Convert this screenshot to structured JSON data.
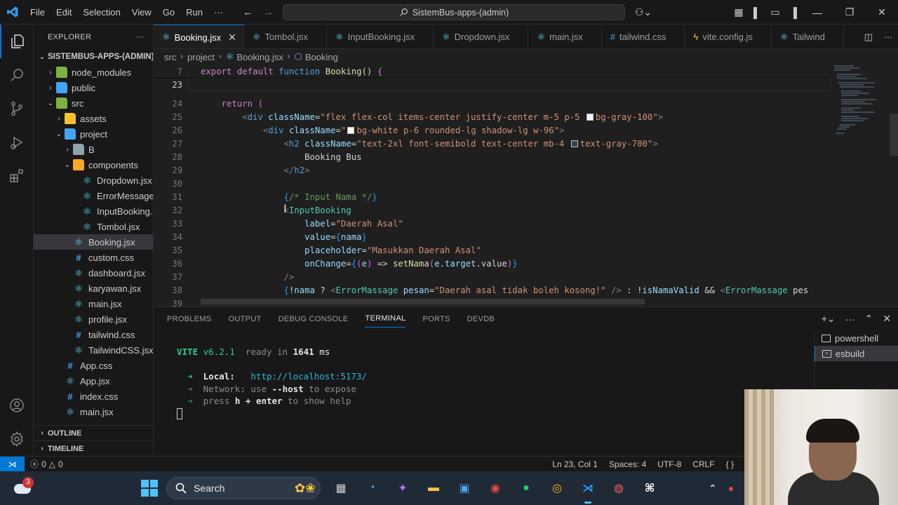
{
  "menu": [
    "File",
    "Edit",
    "Selection",
    "View",
    "Go",
    "Run",
    "···"
  ],
  "command_center": "SistemBus-apps-(admin)",
  "explorer": {
    "title": "EXPLORER",
    "root": "SISTEMBUS-APPS-(ADMIN)",
    "items": [
      {
        "label": "node_modules",
        "depth": 1,
        "kind": "folder-green",
        "chev": "›"
      },
      {
        "label": "public",
        "depth": 1,
        "kind": "folder-blue",
        "chev": "›"
      },
      {
        "label": "src",
        "depth": 1,
        "kind": "folder-green",
        "chev": "⌄"
      },
      {
        "label": "assets",
        "depth": 2,
        "kind": "folder-orange",
        "chev": "›"
      },
      {
        "label": "project",
        "depth": 2,
        "kind": "folder-blue",
        "chev": "⌄"
      },
      {
        "label": "B",
        "depth": 3,
        "kind": "folder-gray",
        "chev": "›"
      },
      {
        "label": "components",
        "depth": 3,
        "kind": "folder-yellow",
        "chev": "⌄"
      },
      {
        "label": "Dropdown.jsx",
        "depth": 4,
        "kind": "react"
      },
      {
        "label": "ErrorMessage...",
        "depth": 4,
        "kind": "react"
      },
      {
        "label": "InputBooking...",
        "depth": 4,
        "kind": "react"
      },
      {
        "label": "Tombol.jsx",
        "depth": 4,
        "kind": "react"
      },
      {
        "label": "Booking.jsx",
        "depth": 3,
        "kind": "react",
        "selected": true
      },
      {
        "label": "custom.css",
        "depth": 3,
        "kind": "css"
      },
      {
        "label": "dashboard.jsx",
        "depth": 3,
        "kind": "react"
      },
      {
        "label": "karyawan.jsx",
        "depth": 3,
        "kind": "react"
      },
      {
        "label": "main.jsx",
        "depth": 3,
        "kind": "react"
      },
      {
        "label": "profile.jsx",
        "depth": 3,
        "kind": "react"
      },
      {
        "label": "tailwind.css",
        "depth": 3,
        "kind": "css"
      },
      {
        "label": "TailwindCSS.jsx",
        "depth": 3,
        "kind": "react"
      },
      {
        "label": "App.css",
        "depth": 2,
        "kind": "css"
      },
      {
        "label": "App.jsx",
        "depth": 2,
        "kind": "react"
      },
      {
        "label": "index.css",
        "depth": 2,
        "kind": "css"
      },
      {
        "label": "main.jsx",
        "depth": 2,
        "kind": "react"
      }
    ],
    "outline": "OUTLINE",
    "timeline": "TIMELINE"
  },
  "tabs": [
    {
      "label": "Booking.jsx",
      "icon": "react",
      "active": true
    },
    {
      "label": "Tombol.jsx",
      "icon": "react"
    },
    {
      "label": "InputBooking.jsx",
      "icon": "react"
    },
    {
      "label": "Dropdown.jsx",
      "icon": "react"
    },
    {
      "label": "main.jsx",
      "icon": "react"
    },
    {
      "label": "tailwind.css",
      "icon": "css"
    },
    {
      "label": "vite.config.js",
      "icon": "vite"
    },
    {
      "label": "Tailwind",
      "icon": "react"
    }
  ],
  "breadcrumb": [
    "src",
    "project",
    "Booking.jsx",
    "Booking"
  ],
  "editor": {
    "sticky_line": {
      "n": "7",
      "text": "export default function Booking() {"
    },
    "current_line": "23",
    "lines": [
      {
        "n": "24",
        "text": "    return ("
      },
      {
        "n": "25",
        "text": "        <div className=\"flex flex-col items-center justify-center m-5 p-5 bg-gray-100\">"
      },
      {
        "n": "26",
        "text": "            <div className=\"bg-white p-6 rounded-lg shadow-lg w-96\">"
      },
      {
        "n": "27",
        "text": "                <h2 className=\"text-2xl font-semibold text-center mb-4 text-gray-700\">"
      },
      {
        "n": "28",
        "text": "                    Booking Bus"
      },
      {
        "n": "29",
        "text": "                </h2>"
      },
      {
        "n": "30",
        "text": ""
      },
      {
        "n": "31",
        "text": "                {/* Input Nama */}"
      },
      {
        "n": "32",
        "text": "                <InputBooking"
      },
      {
        "n": "33",
        "text": "                    label=\"Daerah Asal\""
      },
      {
        "n": "34",
        "text": "                    value={nama}"
      },
      {
        "n": "35",
        "text": "                    placeholder=\"Masukkan Daerah Asal\""
      },
      {
        "n": "36",
        "text": "                    onChange={(e) => setNama(e.target.value)}"
      },
      {
        "n": "37",
        "text": "                />"
      },
      {
        "n": "38",
        "text": "                {!nama ? <ErrorMassage pesan=\"Daerah asal tidak boleh kosong!\" /> : !isNamaValid && <ErrorMassage pes"
      },
      {
        "n": "39",
        "text": ""
      }
    ]
  },
  "panel": {
    "tabs": [
      "PROBLEMS",
      "OUTPUT",
      "DEBUG CONSOLE",
      "TERMINAL",
      "PORTS",
      "DEVDB"
    ],
    "active_tab": "TERMINAL",
    "terminal": {
      "vite": "VITE",
      "version": "v6.2.1",
      "ready": "ready in",
      "ms_value": "1641",
      "ms": "ms",
      "local_label": "Local:",
      "local_url": "http://localhost:5173/",
      "network_label": "Network:",
      "network_a": "use",
      "network_host": "--host",
      "network_b": "to expose",
      "help_a": "press",
      "help_key": "h + enter",
      "help_b": "to show help"
    },
    "terminals": [
      "powershell",
      "esbuild"
    ]
  },
  "status": {
    "errors": "0",
    "warnings": "0",
    "position": "Ln 23, Col 1",
    "spaces": "Spaces: 4",
    "encoding": "UTF-8",
    "eol": "CRLF",
    "lang": "{ }"
  },
  "taskbar": {
    "search": "Search",
    "weather_badge": "3"
  }
}
